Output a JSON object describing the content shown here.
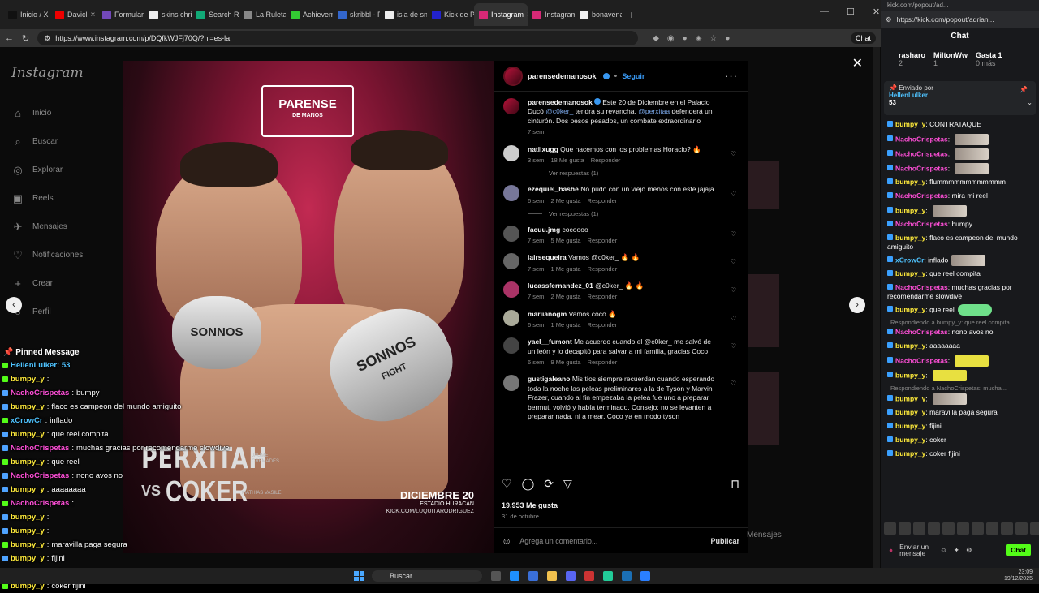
{
  "browser": {
    "tabs": [
      {
        "label": "Inicio / X",
        "color": "#111"
      },
      {
        "label": "Davicl",
        "color": "#e00"
      },
      {
        "label": "Formulario",
        "color": "#7248b9"
      },
      {
        "label": "skins chris",
        "color": "#eee"
      },
      {
        "label": "Search Re",
        "color": "#1a7"
      },
      {
        "label": "La Ruleta",
        "color": "#888"
      },
      {
        "label": "Achievem",
        "color": "#3c3"
      },
      {
        "label": "skribbl - F",
        "color": "#36c"
      },
      {
        "label": "isla de sno",
        "color": "#eee"
      },
      {
        "label": "Kick de Pa",
        "color": "#22c"
      },
      {
        "label": "Instagram",
        "color": "#d62976",
        "active": true
      },
      {
        "label": "Instagram",
        "color": "#d62976"
      },
      {
        "label": "bonavena",
        "color": "#eee"
      }
    ],
    "url": "https://www.instagram.com/p/DQfkWJFj70Q/?hl=es-la",
    "chat_button": "Chat"
  },
  "instagram": {
    "logo": "Instagram",
    "nav": [
      {
        "label": "Inicio",
        "icon": "home-icon",
        "glyph": "⌂"
      },
      {
        "label": "Buscar",
        "icon": "search-icon",
        "glyph": "⌕"
      },
      {
        "label": "Explorar",
        "icon": "compass-icon",
        "glyph": "◎"
      },
      {
        "label": "Reels",
        "icon": "reels-icon",
        "glyph": "▣"
      },
      {
        "label": "Mensajes",
        "icon": "messages-icon",
        "glyph": "✈"
      },
      {
        "label": "Notificaciones",
        "icon": "heart-icon",
        "glyph": "♡"
      },
      {
        "label": "Crear",
        "icon": "plus-icon",
        "glyph": "+"
      },
      {
        "label": "Perfil",
        "icon": "profile-icon",
        "glyph": "○"
      }
    ],
    "post_image": {
      "brand_top": "PARENSE",
      "brand_bottom": "DE MANOS",
      "fighter1": "PERXITAH",
      "vs": "VS",
      "fighter2": "COKER",
      "sub1": "JAUME CREMADES",
      "sub2": "MATHIAS VASILE",
      "date": "DICIEMBRE 20",
      "venue": "ESTADIO HURACAN",
      "channel": "KICK.COM/LUQUITARODRIGUEZ",
      "glove_text": "SONNOS",
      "glove_text2": "FIGHT"
    },
    "post": {
      "author": "parensedemanosok",
      "follow": "Seguir",
      "caption_author": "parensedemanosok",
      "caption": [
        {
          "t": "Este 20 de Diciembre en el Palacio Ducó "
        },
        {
          "t": "@c0ker_",
          "m": true
        },
        {
          "t": " tendra su revancha, "
        },
        {
          "t": "@perxitaa",
          "m": true
        },
        {
          "t": " defenderá un cinturón. Dos pesos pesados, un combate extraordinario"
        }
      ],
      "caption_time": "7 sem",
      "comments": [
        {
          "user": "natiixugg",
          "text": "Que hacemos con los problemas Horacio? 🔥",
          "time": "3 sem",
          "likes": "18 Me gusta",
          "reply": "Responder",
          "replies": "Ver respuestas (1)",
          "color": "#ccc"
        },
        {
          "user": "ezequiel_hashe",
          "text": "No pudo con un viejo menos con este jajaja",
          "time": "6 sem",
          "likes": "2 Me gusta",
          "reply": "Responder",
          "replies": "Ver respuestas (1)",
          "color": "#779"
        },
        {
          "user": "facuu.jmg",
          "text": "cocoooo",
          "time": "7 sem",
          "likes": "5 Me gusta",
          "reply": "Responder",
          "color": "#555"
        },
        {
          "user": "iairsequeira",
          "text": "Vamos @c0ker_ 🔥 🔥",
          "time": "7 sem",
          "likes": "1 Me gusta",
          "reply": "Responder",
          "color": "#666"
        },
        {
          "user": "lucassfernandez_01",
          "text": "@c0ker_ 🔥 🔥",
          "time": "7 sem",
          "likes": "2 Me gusta",
          "reply": "Responder",
          "color": "#a36"
        },
        {
          "user": "mariianogm",
          "text": "Vamos coco 🔥",
          "time": "6 sem",
          "likes": "1 Me gusta",
          "reply": "Responder",
          "color": "#aa9"
        },
        {
          "user": "yael__fumont",
          "text": "Me acuerdo cuando el @c0ker_ me salvó de un león y lo decapitó para salvar a mi familia, gracias Coco",
          "time": "6 sem",
          "likes": "9 Me gusta",
          "reply": "Responder",
          "color": "#444"
        },
        {
          "user": "gustigaleano",
          "text": "Mis tíos siempre recuerdan cuando esperando toda la noche las peleas preliminares a la de Tyson y Marvin Frazer, cuando al fin empezaba la pelea fue uno a preparar bermut, volvió y había terminado. Consejo: no se levanten a preparar nada, ni a mear. Coco ya en modo tyson",
          "time": "",
          "likes": "",
          "reply": "",
          "color": "#777"
        }
      ],
      "likes_count": "19.953 Me gusta",
      "date": "31 de octubre",
      "comment_placeholder": "Agrega un comentario...",
      "publish": "Publicar"
    },
    "messages_label": "Mensajes"
  },
  "overlay": {
    "pinned_title": "Pinned Message",
    "pinned_line": "HellenLulker: 53",
    "lines": [
      {
        "user": "bumpy_y",
        "text": "",
        "color": "#ffeb3b"
      },
      {
        "user": "NachoCrispetas",
        "text": "bumpy",
        "color": "#ff4fd8"
      },
      {
        "user": "bumpy_y",
        "text": "flaco es campeon del mundo amiguito",
        "color": "#ffeb3b"
      },
      {
        "user": "xCrowCr",
        "text": "inflado",
        "color": "#4fc3ff"
      },
      {
        "user": "bumpy_y",
        "text": "que reel compita",
        "color": "#ffeb3b"
      },
      {
        "user": "NachoCrispetas",
        "text": "muchas gracias por recomendarme slowdive",
        "color": "#ff4fd8"
      },
      {
        "user": "bumpy_y",
        "text": "que reel",
        "color": "#ffeb3b"
      },
      {
        "user": "NachoCrispetas",
        "text": "nono avos no",
        "color": "#ff4fd8"
      },
      {
        "user": "bumpy_y",
        "text": "aaaaaaaa",
        "color": "#ffeb3b"
      },
      {
        "user": "NachoCrispetas",
        "text": "",
        "color": "#ff4fd8"
      },
      {
        "user": "bumpy_y",
        "text": "",
        "color": "#ffeb3b"
      },
      {
        "user": "bumpy_y",
        "text": "",
        "color": "#ffeb3b"
      },
      {
        "user": "bumpy_y",
        "text": "maravilla paga segura",
        "color": "#ffeb3b"
      },
      {
        "user": "bumpy_y",
        "text": "fijini",
        "color": "#ffeb3b"
      },
      {
        "user": "bumpy_y",
        "text": "coker",
        "color": "#ffeb3b"
      },
      {
        "user": "bumpy_y",
        "text": "coker fijini",
        "color": "#ffeb3b"
      }
    ]
  },
  "kick": {
    "window_title": "kick.com/popout/ad...",
    "url": "https://kick.com/popout/adrian...",
    "chat_title": "Chat",
    "leaders": [
      {
        "name": "rasharo",
        "count": "2"
      },
      {
        "name": "MiltonWw",
        "count": "1"
      },
      {
        "name": "Gasta 1",
        "count": "0 más"
      }
    ],
    "pinned_label": "Enviado por",
    "pinned_user": "HellenLulker",
    "pinned_value": "53",
    "lines": [
      {
        "user": "bumpy_y",
        "text": "CONTRATAQUE",
        "color": "#ffeb3b"
      },
      {
        "user": "NachoCrispetas",
        "text": "",
        "color": "#ff4fd8",
        "emote": "img"
      },
      {
        "user": "NachoCrispetas",
        "text": "",
        "color": "#ff4fd8",
        "emote": "img"
      },
      {
        "user": "NachoCrispetas",
        "text": "",
        "color": "#ff4fd8",
        "emote": "img"
      },
      {
        "user": "bumpy_y",
        "text": "flummmmmmmmmmmm",
        "color": "#ffeb3b"
      },
      {
        "user": "NachoCrispetas",
        "text": "mira mi reel",
        "color": "#ff4fd8"
      },
      {
        "user": "bumpy_y",
        "text": "",
        "color": "#ffeb3b",
        "emote": "img"
      },
      {
        "user": "NachoCrispetas",
        "text": "bumpy",
        "color": "#ff4fd8"
      },
      {
        "user": "bumpy_y",
        "text": "flaco es campeon del mundo amiguito",
        "color": "#ffeb3b"
      },
      {
        "user": "xCrowCr",
        "text": "inflado",
        "color": "#4fc3ff",
        "emote": "img"
      },
      {
        "user": "bumpy_y",
        "text": "que reel compita",
        "color": "#ffeb3b"
      },
      {
        "user": "NachoCrispetas",
        "text": "muchas gracias por recomendarme slowdive",
        "color": "#ff4fd8"
      },
      {
        "user": "bumpy_y",
        "text": "que reel",
        "color": "#ffeb3b",
        "emote": "g"
      },
      {
        "reply": "Respondiendo a bumpy_y: que reel compita"
      },
      {
        "user": "NachoCrispetas",
        "text": "nono avos no",
        "color": "#ff4fd8"
      },
      {
        "user": "bumpy_y",
        "text": "aaaaaaaa",
        "color": "#ffeb3b"
      },
      {
        "user": "NachoCrispetas",
        "text": "",
        "color": "#ff4fd8",
        "emote": "y"
      },
      {
        "user": "bumpy_y",
        "text": "",
        "color": "#ffeb3b",
        "emote": "y"
      },
      {
        "reply": "Respondiendo a NachoCrispetas: mucha..."
      },
      {
        "user": "bumpy_y",
        "text": "",
        "color": "#ffeb3b",
        "emote": "img"
      },
      {
        "user": "bumpy_y",
        "text": "maravilla paga segura",
        "color": "#ffeb3b"
      },
      {
        "user": "bumpy_y",
        "text": "fijini",
        "color": "#ffeb3b"
      },
      {
        "user": "bumpy_y",
        "text": "coker",
        "color": "#ffeb3b"
      },
      {
        "user": "bumpy_y",
        "text": "coker fijini",
        "color": "#ffeb3b"
      }
    ],
    "send_placeholder": "Enviar un mensaje",
    "chat_button": "Chat"
  },
  "taskbar": {
    "search": "Buscar",
    "time": "23:09",
    "date": "19/12/2025"
  }
}
